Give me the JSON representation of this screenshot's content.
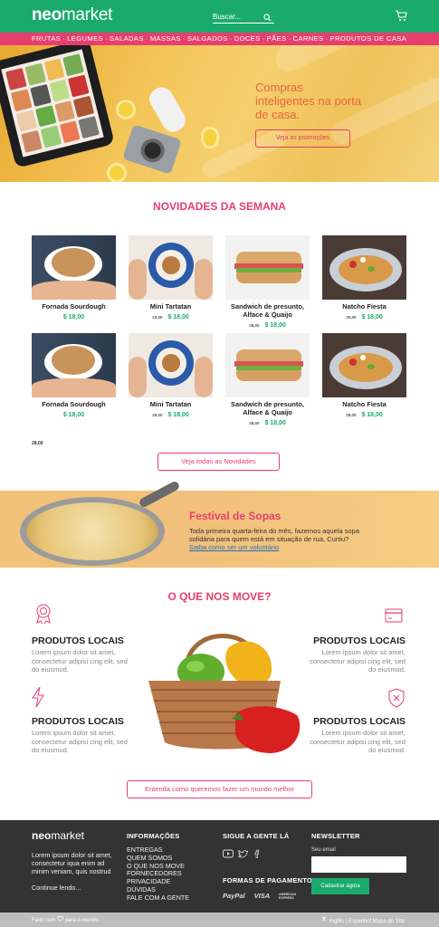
{
  "header": {
    "logo_bold": "neo",
    "logo_rest": "market",
    "search_placeholder": "Buscar...",
    "categories": [
      "FRUTAS",
      "LEGUMES",
      "SALADAS",
      "MASSAS",
      "SALGADOS",
      "DOCES",
      "PÃES",
      "CARNES",
      "PRODUTOS DE CASA"
    ]
  },
  "hero": {
    "title": "Compras inteligentes na porta de casa.",
    "button": "Veja as promoções"
  },
  "novidades": {
    "title": "NOVIDADES DA SEMANA",
    "rows": [
      [
        {
          "name": "Fornada Sourdough",
          "old": "",
          "price": "$ 18,00"
        },
        {
          "name": "Mini Tartatan",
          "old": "23,00",
          "price": "$ 18,00"
        },
        {
          "name": "Sandwich de presunto, Alface & Quaijo",
          "old": "28,00",
          "price": "$ 18,00"
        },
        {
          "name": "Natcho Fiesta",
          "old": "30,00",
          "price": "$ 18,00"
        }
      ],
      [
        {
          "name": "Fornada Sourdough",
          "old": "",
          "price": "$ 18,00"
        },
        {
          "name": "Mini Tartatan",
          "old": "29,00",
          "price": "$ 18,00"
        },
        {
          "name": "Sandwich de presunto, Alface & Quaijo",
          "old": "28,00",
          "price": "$ 18,00"
        },
        {
          "name": "Natcho Fiesta",
          "old": "28,00",
          "price": "$ 18,00"
        }
      ]
    ],
    "stray_price": "28,00",
    "button": "Veja todas as Novidades"
  },
  "festival": {
    "title": "Festival de Sopas",
    "text": "Toda primeira quarta-feira do mês, fazemos aquela sopa solidária para quem está em situação de rua, Curtiu?",
    "link": "Saiba como ser um voluntário"
  },
  "move": {
    "title": "O QUE NOS MOVE?",
    "items": [
      {
        "title": "PRODUTOS LOCAIS",
        "text": "Lorem ipsum dolor sit amet, consectetur adipisi cing elit, sed do eiusmod."
      },
      {
        "title": "PRODUTOS LOCAIS",
        "text": "Lorem ipsum dolor sit amet, consectetur adipisi cing elit, sed do eiusmod."
      },
      {
        "title": "PRODUTOS LOCAIS",
        "text": "Lorem ipsum dolor sit amet, consectetur adipisi cing elit, sed do eiusmod."
      },
      {
        "title": "PRODUTOS LOCAIS",
        "text": "Lorem ipsum dolor sit amet, consectetur adipisi cing elit, sed do eiusmod."
      }
    ],
    "button": "Entenda como queremos fazer um mundo melhor"
  },
  "footer": {
    "logo_bold": "neo",
    "logo_rest": "market",
    "about": "Lorem ipsum dolor sit amet, consectetur iqua enim ad minim veniam, quis nostrud",
    "more": "Continue lendo...",
    "info_title": "INFORMAÇÕES",
    "links": [
      "ENTREGAS",
      "QUEM SOMOS",
      "O QUE NOS MOVE",
      "FORNECEDORES",
      "PRIVACIDADE",
      "DÚVIDAS",
      "FALE COM A GENTE"
    ],
    "social_title": "SIGUE A GENTE LÁ",
    "payment_title": "FORMAS DE PAGAMENTO",
    "payments": [
      "PayPal",
      "VISA",
      "AMERICAN EXPRESS"
    ],
    "newsletter_title": "NEWSLETTER",
    "email_label": "Seu email",
    "subscribe": "Cadastrar agora"
  },
  "bottombar": {
    "left_a": "Feito com",
    "left_b": "para o mundo.",
    "right": "Inglês | Espanhol   Mapa do Site"
  },
  "colors": {
    "green": "#1aab6b",
    "pink": "#e63f6e",
    "dark": "#333333"
  }
}
